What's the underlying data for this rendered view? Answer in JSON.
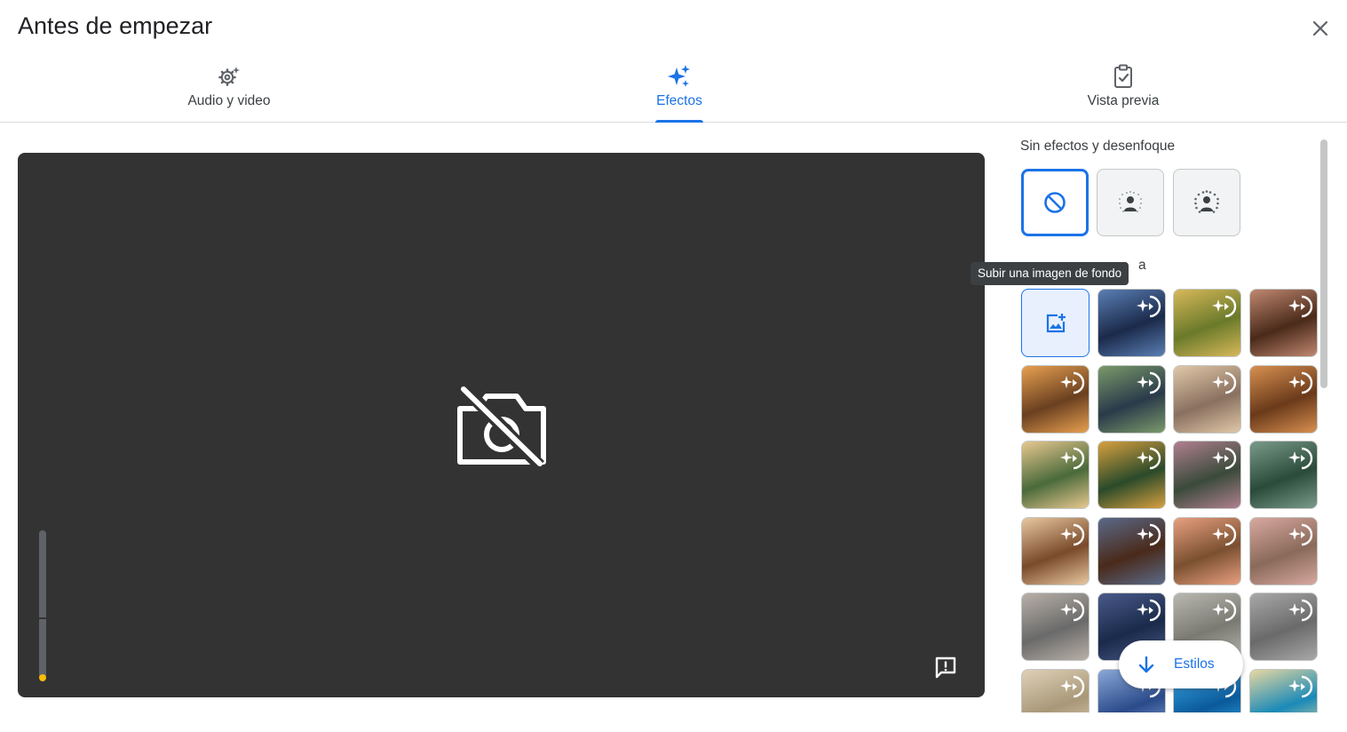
{
  "header": {
    "title": "Antes de empezar"
  },
  "tabs": [
    {
      "label": "Audio y video",
      "icon": "gear-sparkle-icon",
      "active": false
    },
    {
      "label": "Efectos",
      "icon": "sparkle-icon",
      "active": true
    },
    {
      "label": "Vista previa",
      "icon": "clipboard-check-icon",
      "active": false
    }
  ],
  "video": {
    "camera_icon": "camera-off-icon",
    "mic_level": 0.05,
    "feedback_icon": "report-feedback-icon"
  },
  "effects_panel": {
    "section_no_effects": "Sin efectos y desenfoque",
    "section_backgrounds_visible": "a",
    "effect_buttons": [
      {
        "name": "no-effect",
        "icon": "block-icon",
        "selected": true
      },
      {
        "name": "slight-blur",
        "icon": "blur-person-light-icon",
        "selected": false
      },
      {
        "name": "blur",
        "icon": "blur-person-strong-icon",
        "selected": false
      }
    ],
    "upload_icon": "add-photo-icon",
    "tooltip": "Subir una imagen de fondo",
    "background_thumbnails": [
      {
        "theme": "space-cockpit",
        "colors": [
          "#1b2a4a",
          "#5a7fb5"
        ]
      },
      {
        "theme": "fairy-mushroom",
        "colors": [
          "#6a7a2a",
          "#d8b85a"
        ]
      },
      {
        "theme": "library-pink-chair",
        "colors": [
          "#4a2a1a",
          "#c08870"
        ]
      },
      {
        "theme": "cozy-porch-sunset",
        "colors": [
          "#6a4020",
          "#e8a050"
        ]
      },
      {
        "theme": "night-balcony",
        "colors": [
          "#2a3a4a",
          "#7a9a6a"
        ]
      },
      {
        "theme": "warm-living-room",
        "colors": [
          "#8a7060",
          "#e0c8a8"
        ]
      },
      {
        "theme": "fireplace-room",
        "colors": [
          "#6a3a1a",
          "#d89050"
        ]
      },
      {
        "theme": "street-houses-day",
        "colors": [
          "#4a6a3a",
          "#e8c890"
        ]
      },
      {
        "theme": "street-houses-night",
        "colors": [
          "#2a4a2a",
          "#d8a040"
        ]
      },
      {
        "theme": "greenhouse-pink",
        "colors": [
          "#3a4a3a",
          "#b08090"
        ]
      },
      {
        "theme": "tropical-plants",
        "colors": [
          "#2a4a3a",
          "#7a9a8a"
        ]
      },
      {
        "theme": "lounge-window-day",
        "colors": [
          "#7a4a2a",
          "#e8c8a0"
        ]
      },
      {
        "theme": "lounge-window-night",
        "colors": [
          "#4a2a1a",
          "#5a6a8a"
        ]
      },
      {
        "theme": "japanese-room-sunset",
        "colors": [
          "#7a5030",
          "#e8a080"
        ]
      },
      {
        "theme": "japanese-room-day",
        "colors": [
          "#8a6a5a",
          "#d8a8a0"
        ]
      },
      {
        "theme": "city-lamp-view",
        "colors": [
          "#6a6a6a",
          "#b8b0a8"
        ]
      },
      {
        "theme": "night-sky-desk",
        "colors": [
          "#1a2a4a",
          "#4a5a8a"
        ]
      },
      {
        "theme": "minimal-office",
        "colors": [
          "#7a7a72",
          "#b8b8b0"
        ]
      },
      {
        "theme": "rainy-window",
        "colors": [
          "#6a6a6a",
          "#a8a8a8"
        ]
      },
      {
        "theme": "bright-room",
        "colors": [
          "#a89878",
          "#e0d0b8"
        ]
      },
      {
        "theme": "cartoon-bus",
        "colors": [
          "#2a4a8a",
          "#8aa8d8"
        ]
      },
      {
        "theme": "underwater-blue",
        "colors": [
          "#0a5a9a",
          "#3aa8e8"
        ]
      },
      {
        "theme": "tropical-beach",
        "colors": [
          "#1a8ab8",
          "#e8d8a0"
        ]
      }
    ],
    "thumb_badge_icon": "sparkle-refresh-icon",
    "styles_button": {
      "label": "Estilos",
      "icon": "arrow-down-icon"
    }
  },
  "colors": {
    "accent": "#1a73e8",
    "video_bg": "#333333",
    "level": "#fbbc04"
  }
}
